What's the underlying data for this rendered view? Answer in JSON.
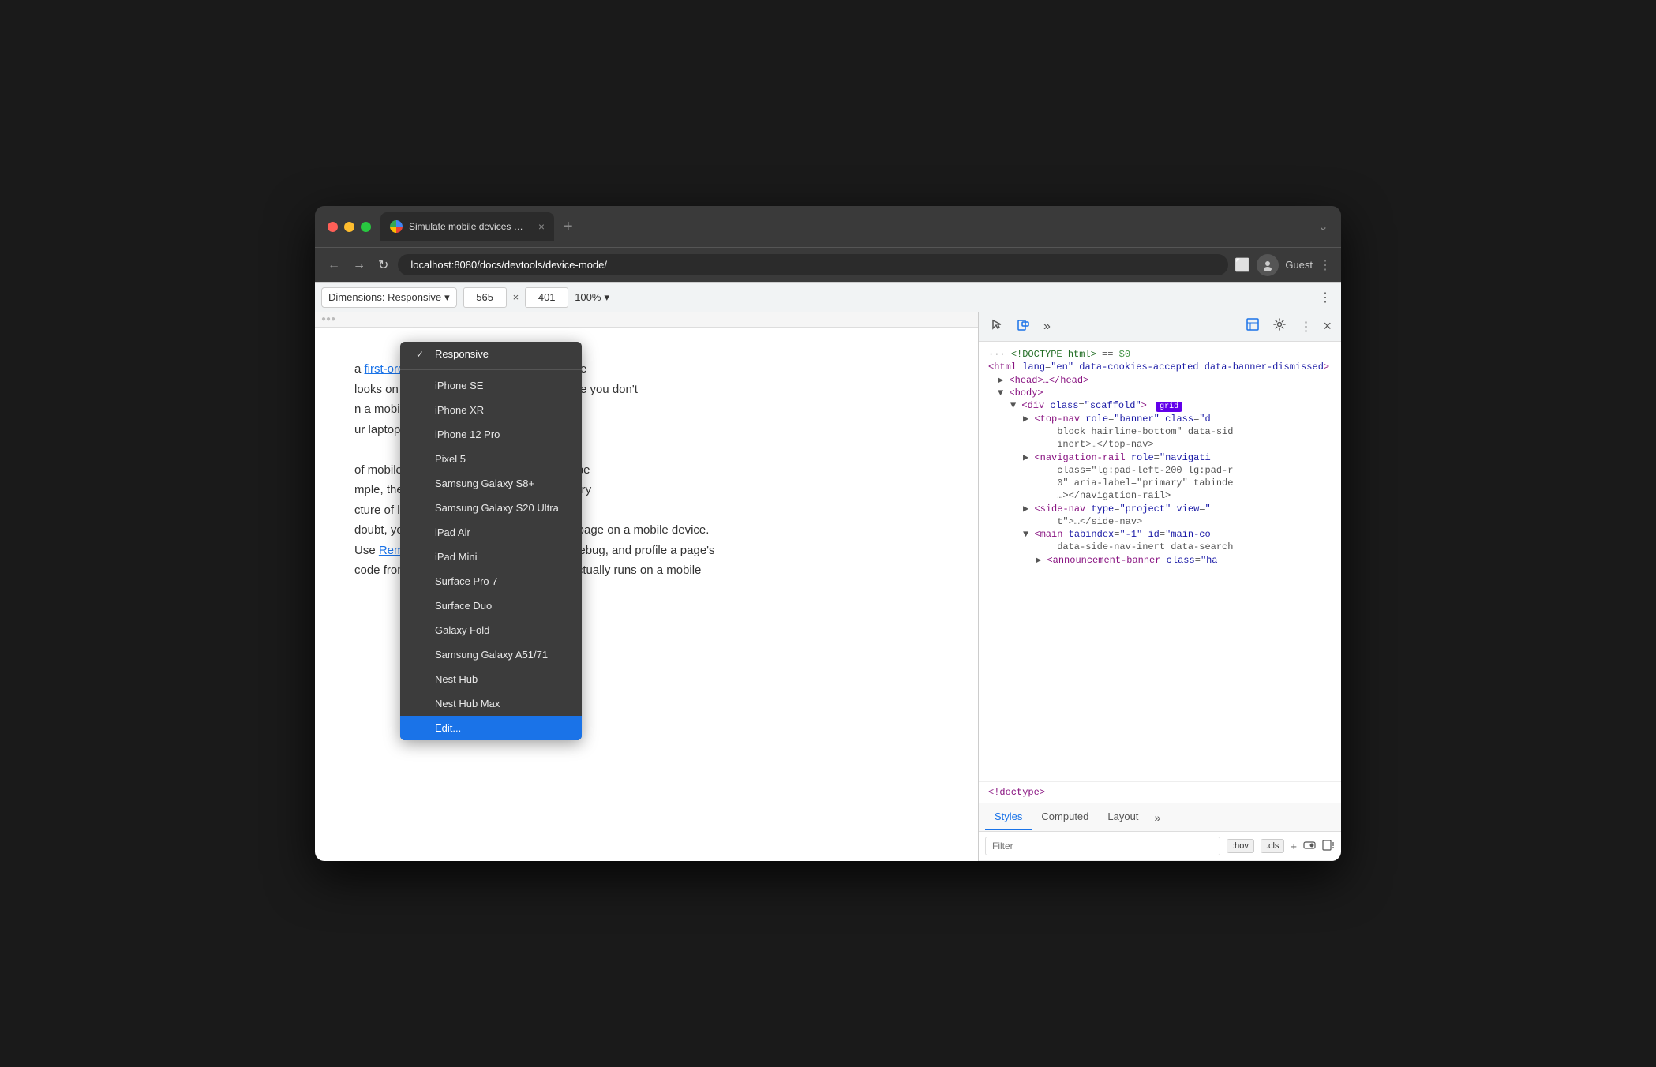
{
  "browser": {
    "title_bar": {
      "tab_title": "Simulate mobile devices with D",
      "tab_close": "×",
      "new_tab": "+",
      "tab_menu": "⌄",
      "guest_label": "Guest"
    },
    "address": {
      "url": "localhost:8080/docs/devtools/device-mode/",
      "back": "←",
      "forward": "→",
      "refresh": "↻"
    }
  },
  "devtools_toolbar": {
    "dimensions_label": "Dimensions: Responsive",
    "width_value": "565",
    "height_value": "401",
    "zoom_label": "100%",
    "separator": "⋮"
  },
  "dropdown_menu": {
    "items": [
      {
        "id": "responsive",
        "label": "Responsive",
        "selected": true
      },
      {
        "id": "iphone-se",
        "label": "iPhone SE",
        "selected": false
      },
      {
        "id": "iphone-xr",
        "label": "iPhone XR",
        "selected": false
      },
      {
        "id": "iphone-12-pro",
        "label": "iPhone 12 Pro",
        "selected": false
      },
      {
        "id": "pixel-5",
        "label": "Pixel 5",
        "selected": false
      },
      {
        "id": "samsung-galaxy-s8",
        "label": "Samsung Galaxy S8+",
        "selected": false
      },
      {
        "id": "samsung-galaxy-s20",
        "label": "Samsung Galaxy S20 Ultra",
        "selected": false
      },
      {
        "id": "ipad-air",
        "label": "iPad Air",
        "selected": false
      },
      {
        "id": "ipad-mini",
        "label": "iPad Mini",
        "selected": false
      },
      {
        "id": "surface-pro-7",
        "label": "Surface Pro 7",
        "selected": false
      },
      {
        "id": "surface-duo",
        "label": "Surface Duo",
        "selected": false
      },
      {
        "id": "galaxy-fold",
        "label": "Galaxy Fold",
        "selected": false
      },
      {
        "id": "samsung-a51",
        "label": "Samsung Galaxy A51/71",
        "selected": false
      },
      {
        "id": "nest-hub",
        "label": "Nest Hub",
        "selected": false
      },
      {
        "id": "nest-hub-max",
        "label": "Nest Hub Max",
        "selected": false
      },
      {
        "id": "edit",
        "label": "Edit...",
        "selected": false,
        "active": true
      }
    ]
  },
  "viewport_content": {
    "text1": "a ",
    "link1": "first-order approximation",
    "text2": " of how your page looks on a mobile device. With Device Mode you don't",
    "text3": "n a mobile device. You simulate the mobile",
    "text4": "ur laptop or desktop.",
    "text5": "of mobile devices that DevTools will never be",
    "text6": "mple, the architecture of mobile CPUs is very",
    "text7": "cture of laptop or desktop CPUs. When in",
    "text8": "doubt, your best bet is to actually run your page on a mobile device.",
    "link2_text": "Remote Debugging",
    "text9": " to view, change, debug, and profile a page's",
    "text10": "code from your laptop or desktop while it actually runs on a mobile"
  },
  "devtools_panel": {
    "html_code": [
      {
        "indent": 0,
        "content": "···<!DOCTYPE html> == $0",
        "type": "comment"
      },
      {
        "indent": 0,
        "content": "<html lang=\"en\" data-cookies-accepted data-banner-dismissed>",
        "type": "tag"
      },
      {
        "indent": 1,
        "content": "▶ <head>…</head>",
        "type": "collapsed"
      },
      {
        "indent": 1,
        "content": "▼ <body>",
        "type": "open"
      },
      {
        "indent": 2,
        "content": "▼ <div class=\"scaffold\">",
        "type": "open",
        "badge": "grid"
      },
      {
        "indent": 3,
        "content": "▶ <top-nav role=\"banner\" class=\"d block hairline-bottom\" data-sid inert>…</top-nav>",
        "type": "collapsed"
      },
      {
        "indent": 3,
        "content": "▶ <navigation-rail role=\"navigati class=\"lg:pad-left-200 lg:pad-r 0\" aria-label=\"primary\" tabinde …></navigation-rail>",
        "type": "collapsed"
      },
      {
        "indent": 3,
        "content": "▶ <side-nav type=\"project\" view=\" t\">…</side-nav>",
        "type": "collapsed"
      },
      {
        "indent": 3,
        "content": "▼ <main tabindex=\"-1\" id=\"main-co data-side-nav-inert data-search",
        "type": "open"
      },
      {
        "indent": 4,
        "content": "▶ <announcement-banner class=\"ha",
        "type": "collapsed"
      }
    ],
    "doctype_bottom": "<!doctype>",
    "tabs": [
      {
        "id": "styles",
        "label": "Styles",
        "active": true
      },
      {
        "id": "computed",
        "label": "Computed",
        "active": false
      },
      {
        "id": "layout",
        "label": "Layout",
        "active": false
      },
      {
        "id": "more",
        "label": "»",
        "active": false
      }
    ],
    "filter": {
      "placeholder": "Filter",
      "pseudo_hov": ":hov",
      "pseudo_cls": ".cls"
    }
  }
}
